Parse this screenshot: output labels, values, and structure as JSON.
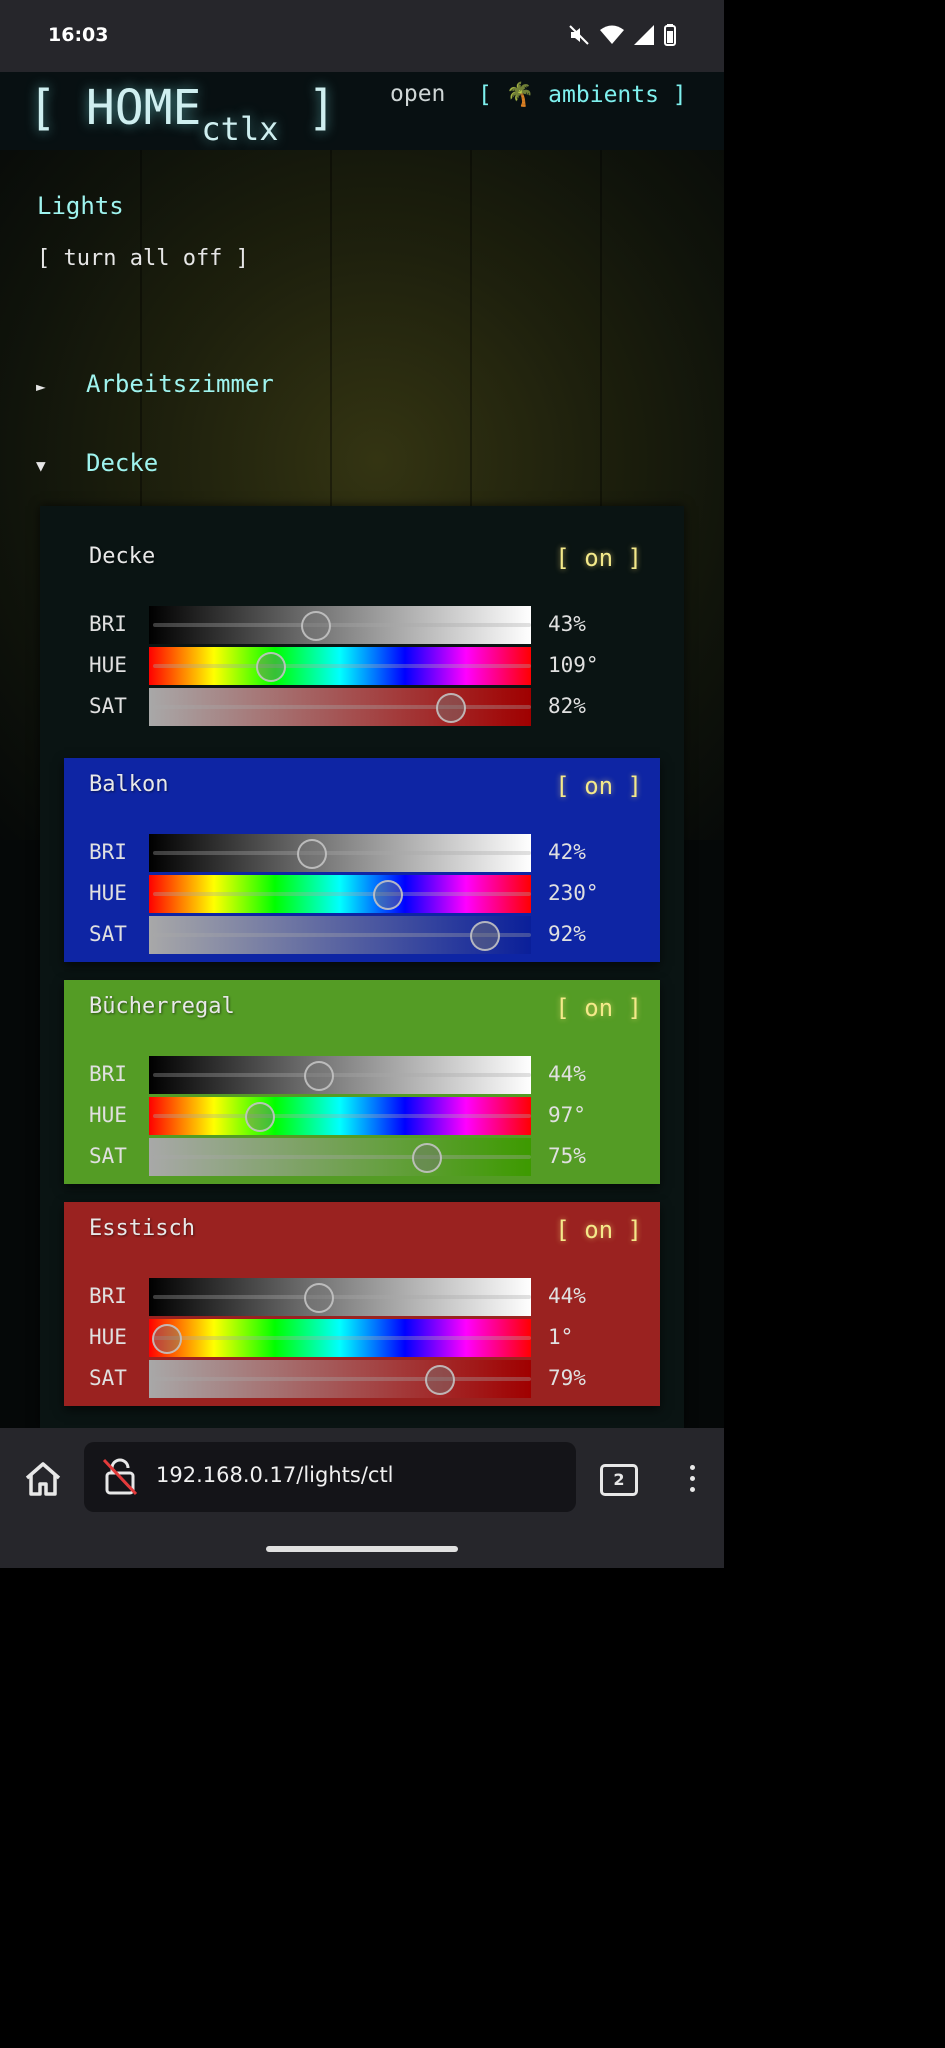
{
  "statusbar": {
    "time": "16:03"
  },
  "header": {
    "logo_bracket_open": "[",
    "logo_main": "HOME",
    "logo_sub": "ctlx",
    "logo_bracket_close": "]",
    "nav_open": "open",
    "nav_ambients": "[ 🌴 ambients ]"
  },
  "page": {
    "title": "Lights",
    "turn_all_off": "[ turn all off ]"
  },
  "rooms": [
    {
      "name": "Arbeitszimmer",
      "arrow": "►"
    },
    {
      "name": "Decke",
      "arrow": "▼"
    }
  ],
  "labels": {
    "bri": "BRI",
    "hue": "HUE",
    "sat": "SAT"
  },
  "lights": [
    {
      "name": "Decke",
      "state": "[ on ]",
      "bri": "43%",
      "hue": "109°",
      "sat": "82%",
      "bri_level": 0.43,
      "hue_level": 0.3,
      "sat_level": 0.82,
      "bg": "transparent",
      "sat_color": "#a00000"
    },
    {
      "name": "Balkon",
      "state": "[ on ]",
      "bri": "42%",
      "hue": "230°",
      "sat": "92%",
      "bri_level": 0.42,
      "hue_level": 0.64,
      "sat_level": 0.92,
      "bg": "#0e25a4",
      "sat_color": "#0a1f9a"
    },
    {
      "name": "Bücherregal",
      "state": "[ on ]",
      "bri": "44%",
      "hue": "97°",
      "sat": "75%",
      "bri_level": 0.44,
      "hue_level": 0.27,
      "sat_level": 0.75,
      "bg": "#549c25",
      "sat_color": "#3d9a00"
    },
    {
      "name": "Esstisch",
      "state": "[ on ]",
      "bri": "44%",
      "hue": "1°",
      "sat": "79%",
      "bri_level": 0.44,
      "hue_level": 0.0,
      "sat_level": 0.79,
      "bg": "#9a2220",
      "sat_color": "#a00000"
    }
  ],
  "browser": {
    "url": "192.168.0.17/lights/ctl",
    "tab_count": "2"
  }
}
